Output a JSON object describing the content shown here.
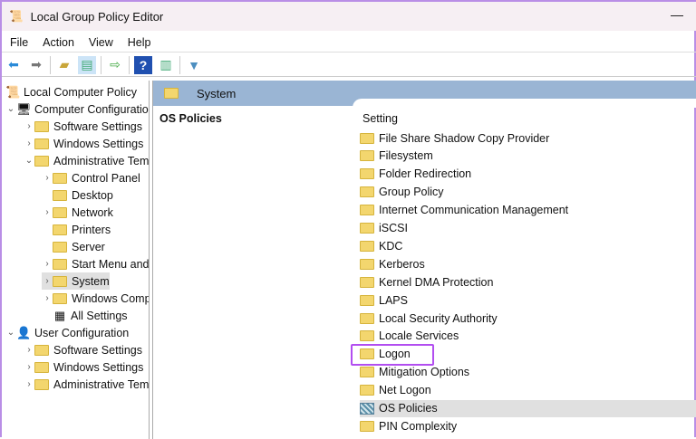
{
  "window": {
    "title": "Local Group Policy Editor",
    "minimize": "—"
  },
  "menu": [
    "File",
    "Action",
    "View",
    "Help"
  ],
  "toolbar": [
    "back-icon",
    "forward-icon",
    "up-folder-icon",
    "show-hide-tree-icon",
    "export-icon",
    "help-icon",
    "action-pane-icon",
    "filter-icon"
  ],
  "tree": [
    {
      "label": "Local Computer Policy",
      "depth": 0,
      "chev": "",
      "icon": "policy"
    },
    {
      "label": "Computer Configuration",
      "depth": 0,
      "chev": "v",
      "icon": "computer"
    },
    {
      "label": "Software Settings",
      "depth": 1,
      "chev": ">",
      "icon": "folder"
    },
    {
      "label": "Windows Settings",
      "depth": 1,
      "chev": ">",
      "icon": "folder"
    },
    {
      "label": "Administrative Templates",
      "depth": 1,
      "chev": "v",
      "icon": "folder"
    },
    {
      "label": "Control Panel",
      "depth": 2,
      "chev": ">",
      "icon": "folder"
    },
    {
      "label": "Desktop",
      "depth": 2,
      "chev": "",
      "icon": "folder"
    },
    {
      "label": "Network",
      "depth": 2,
      "chev": ">",
      "icon": "folder"
    },
    {
      "label": "Printers",
      "depth": 2,
      "chev": "",
      "icon": "folder"
    },
    {
      "label": "Server",
      "depth": 2,
      "chev": "",
      "icon": "folder"
    },
    {
      "label": "Start Menu and Taskbar",
      "depth": 2,
      "chev": ">",
      "icon": "folder"
    },
    {
      "label": "System",
      "depth": 2,
      "chev": ">",
      "icon": "folder",
      "selected": true
    },
    {
      "label": "Windows Components",
      "depth": 2,
      "chev": ">",
      "icon": "folder"
    },
    {
      "label": "All Settings",
      "depth": 2,
      "chev": "",
      "icon": "settings"
    },
    {
      "label": "User Configuration",
      "depth": 0,
      "chev": "v",
      "icon": "user"
    },
    {
      "label": "Software Settings",
      "depth": 1,
      "chev": ">",
      "icon": "folder"
    },
    {
      "label": "Windows Settings",
      "depth": 1,
      "chev": ">",
      "icon": "folder"
    },
    {
      "label": "Administrative Templates",
      "depth": 1,
      "chev": ">",
      "icon": "folder"
    }
  ],
  "main": {
    "header": "System",
    "section": "OS Policies",
    "column": "Setting",
    "items": [
      {
        "label": "File Share Shadow Copy Provider"
      },
      {
        "label": "Filesystem"
      },
      {
        "label": "Folder Redirection"
      },
      {
        "label": "Group Policy"
      },
      {
        "label": "Internet Communication Management"
      },
      {
        "label": "iSCSI"
      },
      {
        "label": "KDC"
      },
      {
        "label": "Kerberos"
      },
      {
        "label": "Kernel DMA Protection"
      },
      {
        "label": "LAPS"
      },
      {
        "label": "Local Security Authority"
      },
      {
        "label": "Locale Services"
      },
      {
        "label": "Logon",
        "highlighted": true
      },
      {
        "label": "Mitigation Options"
      },
      {
        "label": "Net Logon"
      },
      {
        "label": "OS Policies",
        "selected": true,
        "icon": "policy-setting"
      },
      {
        "label": "PIN Complexity"
      }
    ]
  },
  "colors": {
    "highlight": "#b24ef0",
    "header": "#9ab5d4",
    "border": "#b98ee6"
  }
}
